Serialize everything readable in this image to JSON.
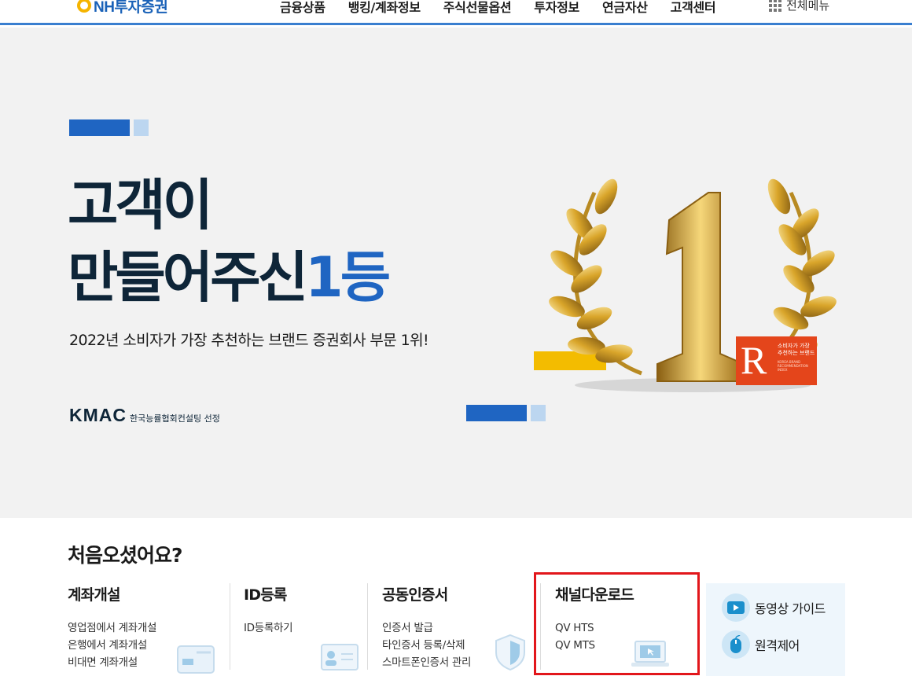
{
  "header": {
    "logo_text": "NH투자증권",
    "nav": [
      "금융상품",
      "뱅킹/계좌정보",
      "주식선물옵션",
      "투자정보",
      "연금자산",
      "고객센터"
    ],
    "all_menu": "전체메뉴"
  },
  "hero": {
    "title_line1": "고객이",
    "title_line2": "만들어주신",
    "title_accent": "1등",
    "subtitle": "2022년 소비자가 가장 추천하는 브랜드 증권회사 부문 1위!",
    "kmac_logo": "KMAC",
    "kmac_text": "한국능률협회컨설팅 선정",
    "badge_r": "R",
    "badge_text": "소비자가 가장 추천하는 브랜드",
    "badge_small": "KOREA BRAND RECOMMENDATION INDEX",
    "trophy_number": "1"
  },
  "welcome": {
    "title": "처음오셨어요?",
    "columns": [
      {
        "title": "계좌개설",
        "links": [
          "영업점에서 계좌개설",
          "은행에서 계좌개설",
          "비대면 계좌개설"
        ],
        "icon": "card-icon"
      },
      {
        "title": "ID등록",
        "links": [
          "ID등록하기"
        ],
        "icon": "id-card-icon"
      },
      {
        "title": "공동인증서",
        "links": [
          "인증서 발급",
          "타인증서 등록/삭제",
          "스마트폰인증서 관리"
        ],
        "icon": "shield-icon"
      },
      {
        "title": "채널다운로드",
        "links": [
          "QV HTS",
          "QV MTS"
        ],
        "icon": "laptop-icon"
      }
    ],
    "side": {
      "video_guide": "동영상 가이드",
      "remote_control": "원격제어"
    }
  },
  "colors": {
    "brand_blue": "#1f65c2",
    "header_line": "#3a7fd0",
    "navy": "#0e2538",
    "highlight_red": "#e2161b",
    "badge_orange": "#e4451b",
    "gold": "#d9a52a"
  }
}
